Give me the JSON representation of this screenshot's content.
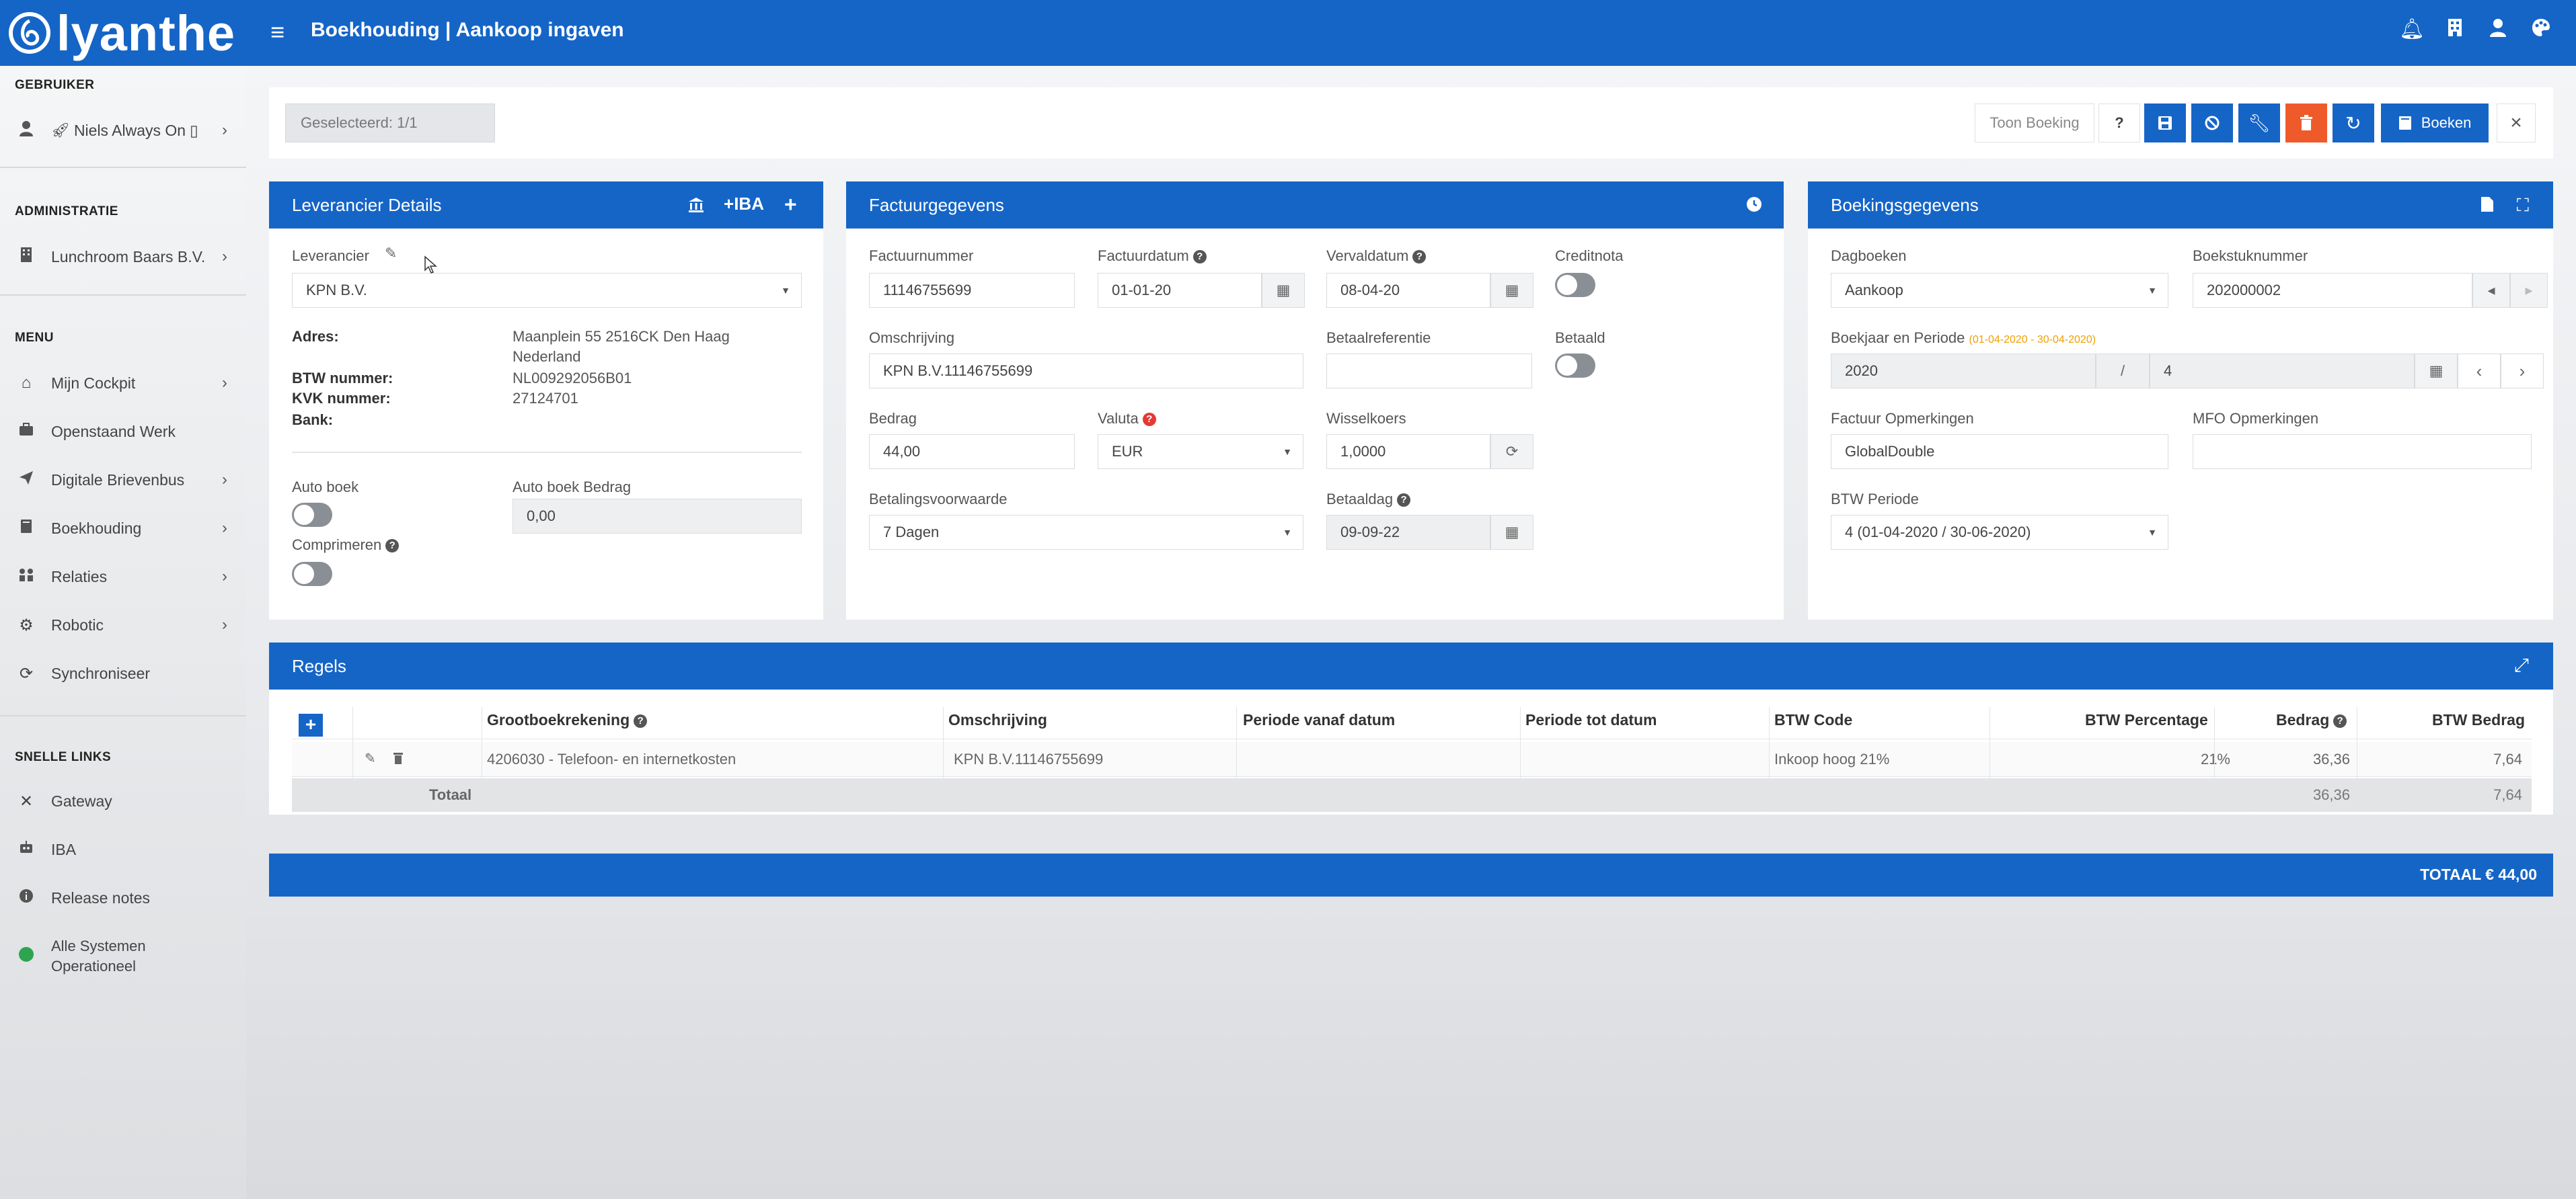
{
  "app": {
    "logo_text": "lyanthe",
    "page_title": "Boekhouding | Aankoop ingaven"
  },
  "topbar_icons": [
    "bell-icon",
    "building-icon",
    "user-icon",
    "palette-icon"
  ],
  "sidebar": {
    "user_heading": "GEBRUIKER",
    "user_name": "Niels Always On",
    "admin_heading": "ADMINISTRATIE",
    "admin_name": "Lunchroom Baars B.V.",
    "menu_heading": "MENU",
    "menu_items": [
      {
        "label": "Mijn Cockpit",
        "icon": "home-icon",
        "chevron": true
      },
      {
        "label": "Openstaand Werk",
        "icon": "briefcase-icon",
        "chevron": false
      },
      {
        "label": "Digitale Brievenbus",
        "icon": "paper-plane-icon",
        "chevron": true
      },
      {
        "label": "Boekhouding",
        "icon": "book-icon",
        "chevron": true
      },
      {
        "label": "Relaties",
        "icon": "people-icon",
        "chevron": true
      },
      {
        "label": "Robotic",
        "icon": "cogs-icon",
        "chevron": true
      },
      {
        "label": "Synchroniseer",
        "icon": "sync-icon",
        "chevron": false
      }
    ],
    "links_heading": "SNELLE LINKS",
    "links": [
      {
        "label": "Gateway",
        "icon": "tools-icon"
      },
      {
        "label": "IBA",
        "icon": "robot-icon"
      },
      {
        "label": "Release notes",
        "icon": "info-icon"
      }
    ],
    "status_line1": "Alle Systemen",
    "status_line2": "Operationeel",
    "status_color": "#2ea44f"
  },
  "toolbar": {
    "selected": "Geselecteerd: 1/1",
    "show_booking": "Toon Boeking",
    "help": "?",
    "book_label": "Boeken"
  },
  "supplier": {
    "title": "Leverancier Details",
    "iba_label": "IBA",
    "supplier_label": "Leverancier",
    "supplier_value": "KPN B.V.",
    "address_label": "Adres:",
    "address_line1": "Maanplein 55 2516CK Den Haag",
    "address_line2": "Nederland",
    "btw_label": "BTW nummer:",
    "btw_value": "NL009292056B01",
    "kvk_label": "KVK nummer:",
    "kvk_value": "27124701",
    "bank_label": "Bank:",
    "autoboek_label": "Auto boek",
    "autoboek_amount_label": "Auto boek Bedrag",
    "autoboek_amount_value": "0,00",
    "comprimeren_label": "Comprimeren"
  },
  "invoice": {
    "title": "Factuurgegevens",
    "nummer_label": "Factuurnummer",
    "nummer_value": "11146755699",
    "datum_label": "Factuurdatum",
    "datum_value": "01-01-20",
    "verval_label": "Vervaldatum",
    "verval_value": "08-04-20",
    "creditnota_label": "Creditnota",
    "omschrijving_label": "Omschrijving",
    "omschrijving_value": "KPN B.V.11146755699",
    "betaalref_label": "Betaalreferentie",
    "betaalref_value": "",
    "betaald_label": "Betaald",
    "bedrag_label": "Bedrag",
    "bedrag_value": "44,00",
    "valuta_label": "Valuta",
    "valuta_value": "EUR",
    "wissel_label": "Wisselkoers",
    "wissel_value": "1,0000",
    "betalingsvw_label": "Betalingsvoorwaarde",
    "betalingsvw_value": "7 Dagen",
    "betaaldag_label": "Betaaldag",
    "betaaldag_value": "09-09-22"
  },
  "booking": {
    "title": "Boekingsgegevens",
    "dagboeken_label": "Dagboeken",
    "dagboeken_value": "Aankoop",
    "boekstuk_label": "Boekstuknummer",
    "boekstuk_value": "202000002",
    "periode_label": "Boekjaar en Periode",
    "periode_hint": "(01-04-2020 - 30-04-2020)",
    "boekjaar_value": "2020",
    "slash": "/",
    "periode_value": "4",
    "opmerkingen_label": "Factuur Opmerkingen",
    "opmerkingen_value": "GlobalDouble",
    "mfo_label": "MFO Opmerkingen",
    "mfo_value": "",
    "btw_periode_label": "BTW Periode",
    "btw_periode_value": "4 (01-04-2020 / 30-06-2020)"
  },
  "rules": {
    "title": "Regels",
    "columns": [
      "Grootboekrekening",
      "Omschrijving",
      "Periode vanaf datum",
      "Periode tot datum",
      "BTW Code",
      "BTW Percentage",
      "Bedrag",
      "BTW Bedrag"
    ],
    "row": {
      "grootboek": "4206030 - Telefoon- en internetkosten",
      "omschrijving": "KPN B.V.11146755699",
      "vanaf": "",
      "tot": "",
      "btw_code": "Inkoop hoog 21%",
      "btw_pct": "21%",
      "bedrag": "36,36",
      "btw_bedrag": "7,64"
    },
    "total_label": "Totaal",
    "total_bedrag": "36,36",
    "total_btw": "7,64",
    "grand_total": "TOTAAL € 44,00"
  }
}
